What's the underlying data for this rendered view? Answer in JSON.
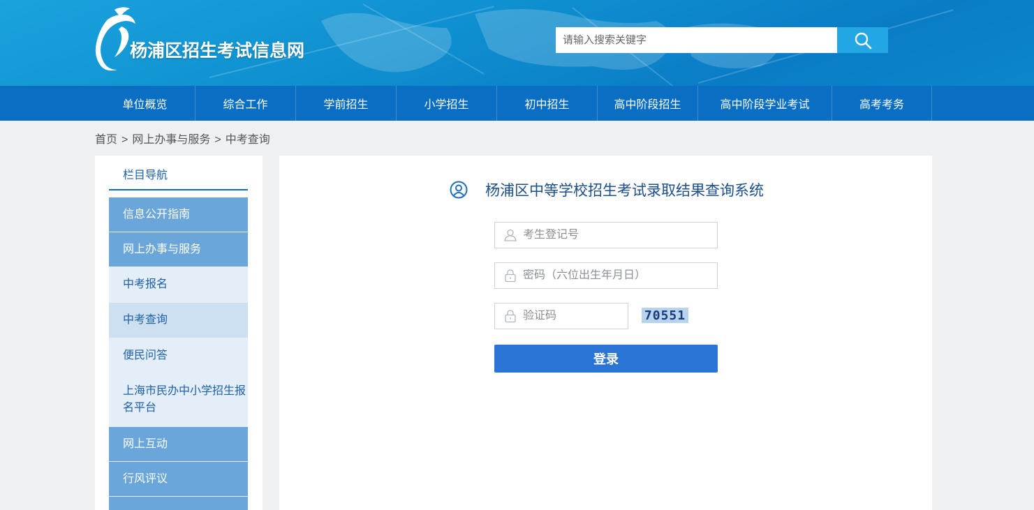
{
  "header": {
    "site_title": "杨浦区招生考试信息网",
    "search_placeholder": "请输入搜索关键字"
  },
  "nav": {
    "items": [
      "单位概览",
      "综合工作",
      "学前招生",
      "小学招生",
      "初中招生",
      "高中阶段招生",
      "高中阶段学业考试",
      "高考考务"
    ]
  },
  "breadcrumb": {
    "home": "首页",
    "section": "网上办事与服务",
    "current": "中考查询",
    "separator": ">"
  },
  "sidebar": {
    "title": "栏目导航",
    "items": [
      {
        "label": "信息公开指南"
      },
      {
        "label": "网上办事与服务"
      },
      {
        "label": "中考报名"
      },
      {
        "label": "中考查询"
      },
      {
        "label": "便民问答"
      },
      {
        "label": "上海市民办中小学招生报名平台"
      },
      {
        "label": "网上互动"
      },
      {
        "label": "行风评议"
      }
    ]
  },
  "main": {
    "system_title": "杨浦区中等学校招生考试录取结果查询系统",
    "registration_placeholder": "考生登记号",
    "password_placeholder": "密码（六位出生年月日）",
    "captcha_placeholder": "验证码",
    "captcha_code": "70551",
    "login_label": "登录"
  },
  "colors": {
    "header_blue": "#0e8ecf",
    "nav_blue": "#0a6fc2",
    "sidebar_primary": "#6aa6d9",
    "sidebar_secondary": "#e3eef9",
    "button_blue": "#2a74d6",
    "title_text": "#1b4e8a"
  }
}
